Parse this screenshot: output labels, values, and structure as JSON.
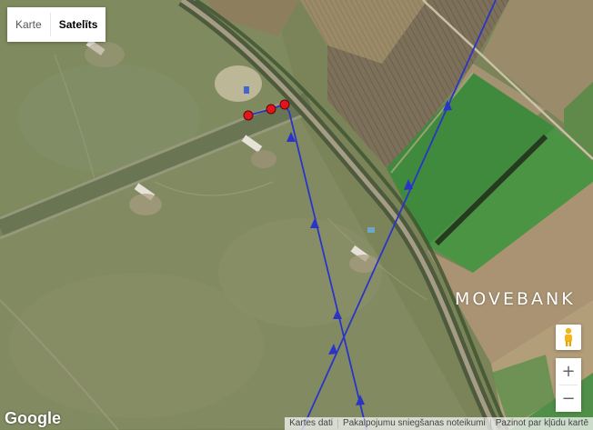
{
  "map_type_control": {
    "map_label": "Karte",
    "satellite_label": "Satelīts",
    "active": "satellite"
  },
  "branding": {
    "watermark": "MOVEBANK",
    "google_logo": "Google"
  },
  "footer": {
    "map_data": "Kartes dati",
    "terms": "Pakalpojumu sniegšanas noteikumi",
    "report_error": "Pazinot par kļūdu kartē"
  },
  "zoom": {
    "in_label": "+",
    "out_label": "−"
  },
  "colors": {
    "track": "#2a35c8",
    "fix_marker": "#e3141c",
    "marker_outline": "#5a0a0a"
  },
  "icons": {
    "street_view": "pegman-icon"
  }
}
